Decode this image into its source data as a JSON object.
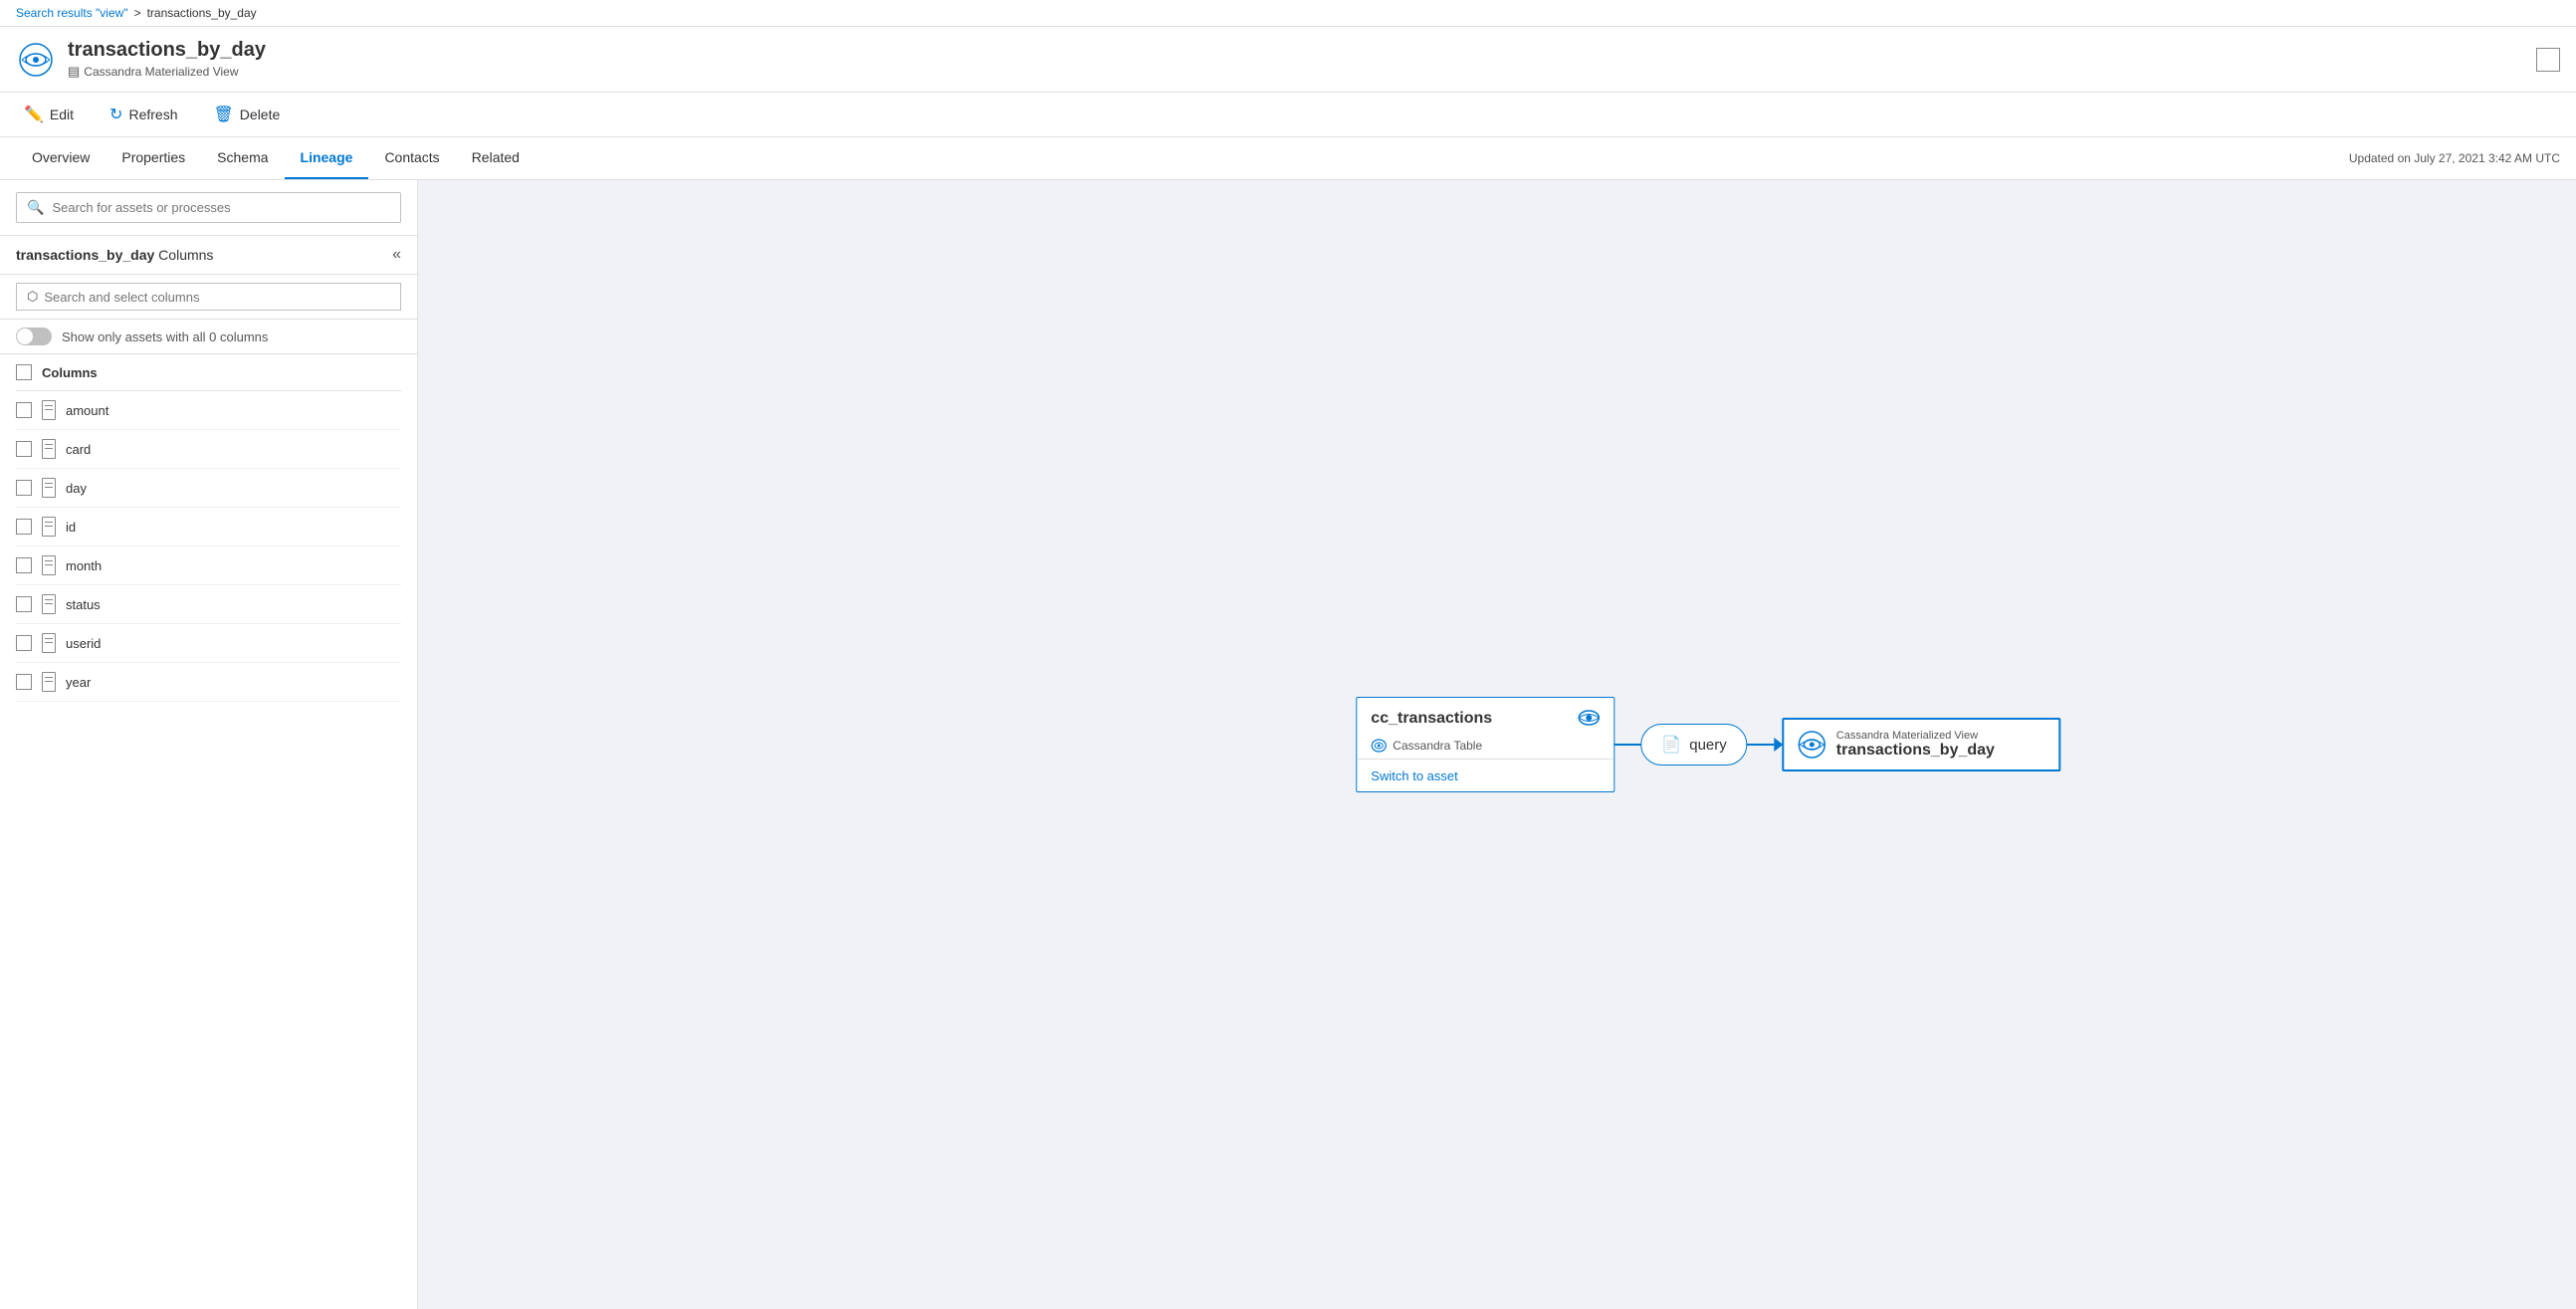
{
  "breadcrumb": {
    "link": "Search results \"view\"",
    "separator": ">",
    "current": "transactions_by_day"
  },
  "header": {
    "title": "transactions_by_day",
    "subtitle": "Cassandra Materialized View",
    "subtitle_icon": "table-icon"
  },
  "toolbar": {
    "edit_label": "Edit",
    "refresh_label": "Refresh",
    "delete_label": "Delete"
  },
  "tabs": {
    "items": [
      "Overview",
      "Properties",
      "Schema",
      "Lineage",
      "Contacts",
      "Related"
    ],
    "active_index": 3,
    "updated_text": "Updated on July 27, 2021 3:42 AM UTC"
  },
  "search_top": {
    "placeholder": "Search for assets or processes"
  },
  "column_panel": {
    "title_bold": "transactions_by_day",
    "title_rest": " Columns",
    "search_placeholder": "Search and select columns",
    "toggle_label": "Show only assets with all 0 columns",
    "columns_header": "Columns",
    "columns": [
      {
        "name": "amount"
      },
      {
        "name": "card"
      },
      {
        "name": "day"
      },
      {
        "name": "id"
      },
      {
        "name": "month"
      },
      {
        "name": "status"
      },
      {
        "name": "userid"
      },
      {
        "name": "year"
      }
    ]
  },
  "lineage": {
    "source_node": {
      "title": "cc_transactions",
      "subtitle": "Cassandra Table",
      "eye_icon_title": "eye-icon",
      "link_text": "Switch to asset"
    },
    "process_node": {
      "icon": "doc-icon",
      "label": "query"
    },
    "target_node": {
      "subtitle": "Cassandra Materialized View",
      "title": "transactions_by_day"
    }
  }
}
